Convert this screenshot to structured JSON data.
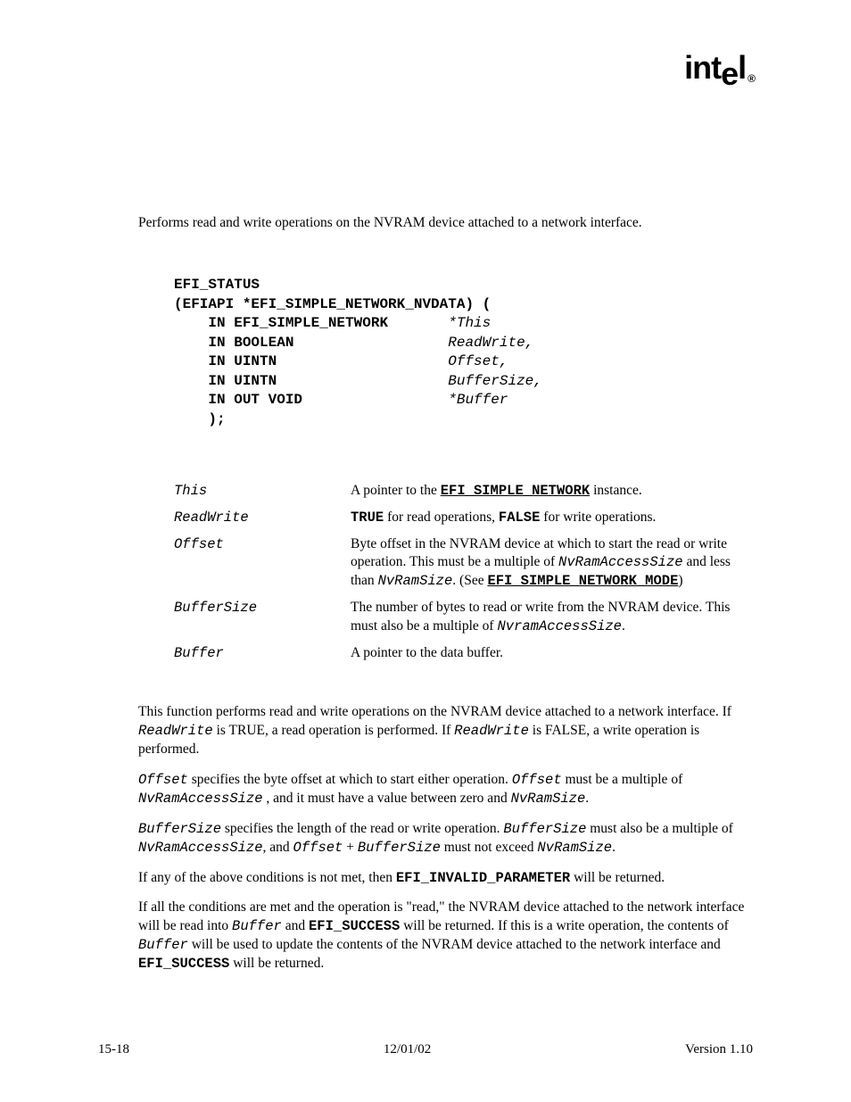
{
  "logo": {
    "text": "intel"
  },
  "summary": "Performs read and write operations on the NVRAM device attached to a network interface.",
  "prototype": {
    "l1a": "EFI_STATUS",
    "l2a": "(EFIAPI *EFI_SIMPLE_NETWORK_NVDATA) (",
    "l3a": "    IN EFI_SIMPLE_NETWORK       ",
    "l3b": "*This",
    "l4a": "    IN BOOLEAN                  ",
    "l4b": "ReadWrite,",
    "l5a": "    IN UINTN                    ",
    "l5b": "Offset,",
    "l6a": "    IN UINTN                    ",
    "l6b": "BufferSize,",
    "l7a": "    IN OUT VOID                 ",
    "l7b": "*Buffer",
    "l8a": "    );"
  },
  "params": {
    "p1": {
      "name": "This",
      "d1": "A pointer to the ",
      "c1": "EFI_SIMPLE_NETWORK",
      "d2": " instance."
    },
    "p2": {
      "name": "ReadWrite",
      "c1": "TRUE",
      "d1": " for read operations, ",
      "c2": "FALSE",
      "d2": " for write operations."
    },
    "p3": {
      "name": "Offset",
      "d1": "Byte offset in the NVRAM device at which to start the read or write operation.  This must be a multiple of ",
      "c1": "NvRamAccessSize",
      "d2": " and less than ",
      "c2": "NvRamSize",
      "d3": ".  (See ",
      "c3": "EFI_SIMPLE_NETWORK_MODE",
      "d4": ")"
    },
    "p4": {
      "name": "BufferSize",
      "d1": "The number of bytes to read or write from the NVRAM device.  This must also be a multiple of ",
      "c1": "NvramAccessSize",
      "d2": "."
    },
    "p5": {
      "name": "Buffer",
      "d1": "A pointer to the data buffer."
    }
  },
  "desc": {
    "p1": {
      "t1": "This function performs read and write operations on the NVRAM device attached to a network interface.  If ",
      "c1": "ReadWrite",
      "t2": " is TRUE, a read operation is performed.  If ",
      "c2": "ReadWrite",
      "t3": " is FALSE, a write operation is performed."
    },
    "p2": {
      "c1": "Offset",
      "t1": " specifies the byte offset at which to start either operation.  ",
      "c2": "Offset",
      "t2": " must be a multiple of ",
      "c3": "NvRamAccessSize",
      "t3": " , and it must have a value between zero and ",
      "c4": "NvRamSize",
      "t4": "."
    },
    "p3": {
      "c1": "BufferSize",
      "t1": " specifies the length of the read or write operation.  ",
      "c2": "BufferSize",
      "t2": " must also be a multiple of ",
      "c3": "NvRamAccessSize",
      "t3": ", and ",
      "c4": "Offset",
      "t4": " + ",
      "c5": "BufferSize",
      "t5": " must not exceed ",
      "c6": "NvRamSize",
      "t6": "."
    },
    "p4": {
      "t1": "If any of the above conditions is not met, then ",
      "c1": "EFI_INVALID_PARAMETER",
      "t2": " will be returned."
    },
    "p5": {
      "t1": "If all the conditions are met and the operation is \"read,\" the NVRAM device attached to the network interface will be read into ",
      "c1": "Buffer",
      "t2": " and ",
      "c2": "EFI_SUCCESS",
      "t3": " will be returned.  If this is a write operation, the contents of ",
      "c3": "Buffer",
      "t4": " will be used to update the contents of the NVRAM device attached to the network interface and ",
      "c4": "EFI_SUCCESS",
      "t5": " will be returned."
    }
  },
  "footer": {
    "left": "15-18",
    "center": "12/01/02",
    "right": "Version 1.10"
  }
}
